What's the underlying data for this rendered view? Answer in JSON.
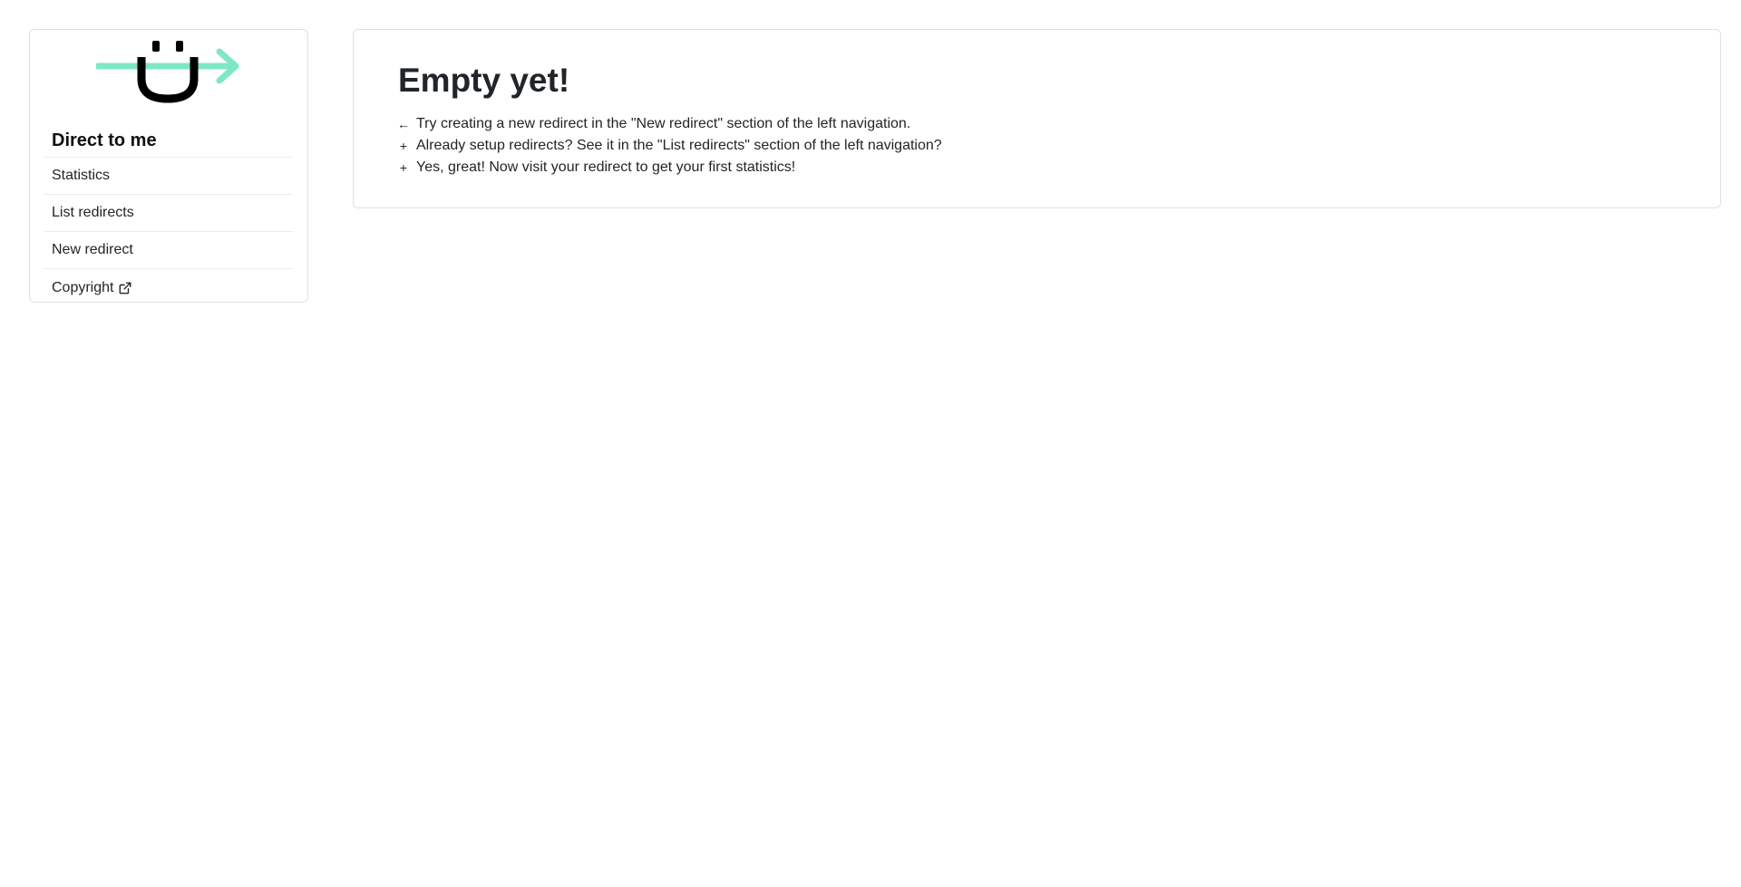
{
  "sidebar": {
    "brand": "Direct to me",
    "logo_icon": "direct-to-me-logo",
    "colors": {
      "accent": "#7ee8c4",
      "logo_dark": "#000000"
    },
    "items": [
      {
        "label": "Statistics"
      },
      {
        "label": "List redirects"
      },
      {
        "label": "New redirect"
      },
      {
        "label": "Copyright",
        "icon": "external-link-icon"
      }
    ]
  },
  "main": {
    "title": "Empty yet!",
    "tips": [
      {
        "icon": "←",
        "text": "Try creating a new redirect in the \"New redirect\" section of the left navigation."
      },
      {
        "icon": "+",
        "text": "Already setup redirects? See it in the \"List redirects\" section of the left navigation?"
      },
      {
        "icon": "+",
        "text": "Yes, great! Now visit your redirect to get your first statistics!"
      }
    ]
  }
}
